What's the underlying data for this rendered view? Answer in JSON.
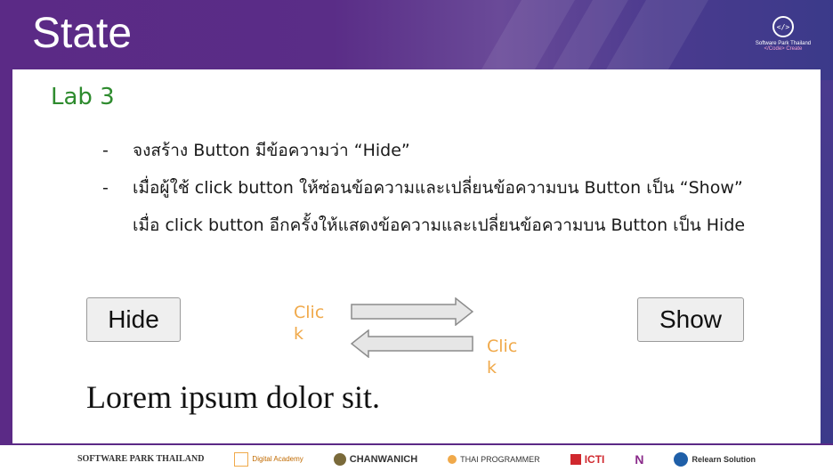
{
  "slide": {
    "title": "State"
  },
  "brand": {
    "name": "Software Park Thailand",
    "tagline": "</Code> Create",
    "icon": "code-pin-icon"
  },
  "lab": {
    "title": "Lab 3"
  },
  "bullets": [
    {
      "text": "จงสร้าง Button มีข้อความว่า “Hide”"
    },
    {
      "text": "เมื่อผู้ใช้ click button ให้ซ่อนข้อความและเปลี่ยนข้อความบน Button เป็น “Show” เมื่อ click button อีกครั้งให้แสดงข้อความและเปลี่ยนข้อความบน Button เป็น Hide"
    }
  ],
  "bullet_marker": "-",
  "demo": {
    "hide_button": "Hide",
    "show_button": "Show",
    "click_label_top": "Click",
    "click_label_bottom": "Click",
    "lorem": "Lorem ipsum dolor sit."
  },
  "footer": {
    "sponsors": [
      {
        "label": "SOFTWARE PARK THAILAND"
      },
      {
        "label": "Digital Academy"
      },
      {
        "label": "CHANWANICH"
      },
      {
        "label": "THAI PROGRAMMER"
      },
      {
        "label": "ICTI"
      },
      {
        "label": "N"
      },
      {
        "label": "Relearn Solution"
      }
    ]
  },
  "colors": {
    "header": "#5b2a86",
    "lab_title": "#2e8b2e",
    "click_label": "#f0a94a"
  }
}
